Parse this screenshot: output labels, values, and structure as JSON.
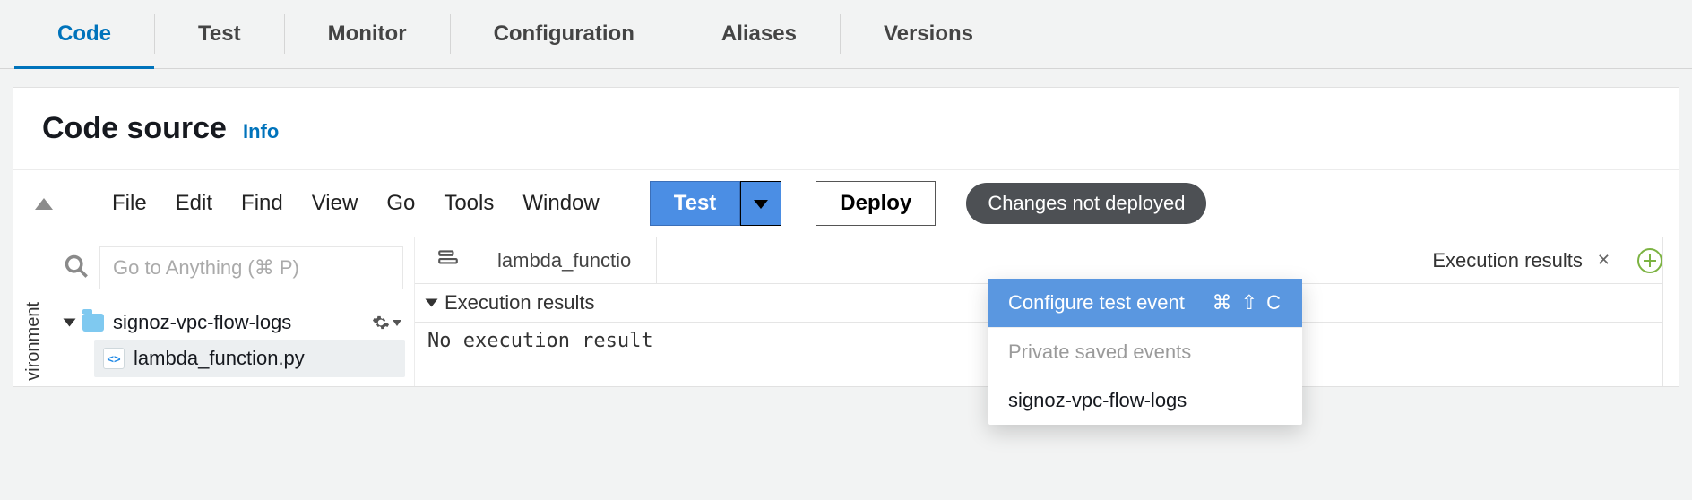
{
  "tabs": [
    "Code",
    "Test",
    "Monitor",
    "Configuration",
    "Aliases",
    "Versions"
  ],
  "active_tab": "Code",
  "panel": {
    "title": "Code source",
    "info": "Info"
  },
  "menubar": [
    "File",
    "Edit",
    "Find",
    "View",
    "Go",
    "Tools",
    "Window"
  ],
  "buttons": {
    "test": "Test",
    "deploy": "Deploy"
  },
  "status_badge": "Changes not deployed",
  "goto_placeholder": "Go to Anything (⌘ P)",
  "tree": {
    "folder": "signoz-vpc-flow-logs",
    "file": "lambda_function.py"
  },
  "editor": {
    "tab_file": "lambda_functio",
    "exec_tab": "Execution results",
    "exec_header": "Execution results",
    "exec_body": "No execution result"
  },
  "dropdown": {
    "configure": "Configure test event",
    "shortcut": "⌘ ⇧ C",
    "heading": "Private saved events",
    "saved": "signoz-vpc-flow-logs"
  },
  "side_label": "vironment"
}
